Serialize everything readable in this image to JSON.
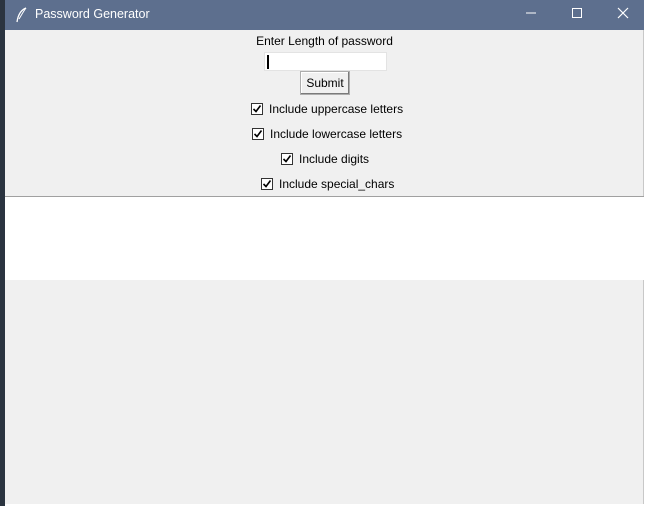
{
  "window": {
    "title": "Password Generator",
    "titlebar_color": "#5d6f8e",
    "icon": "feather-icon"
  },
  "controls": {
    "minimize_icon": "minimize-icon",
    "maximize_icon": "maximize-icon",
    "close_icon": "close-icon"
  },
  "form": {
    "length_label": "Enter Length of password",
    "length_value": "",
    "submit_label": "Submit"
  },
  "options": [
    {
      "label": "Include uppercase letters",
      "checked": true
    },
    {
      "label": "Include lowercase letters",
      "checked": true
    },
    {
      "label": "Include digits",
      "checked": true
    },
    {
      "label": "Include special_chars",
      "checked": true
    }
  ],
  "output": {
    "text": ""
  }
}
